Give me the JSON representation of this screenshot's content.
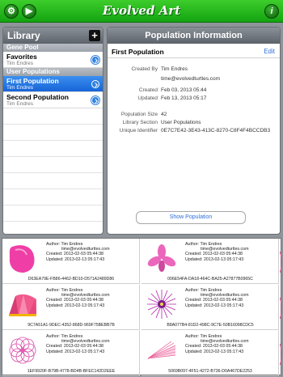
{
  "app": {
    "title": "Evolved Art"
  },
  "toolbar": {
    "settings_icon": "gear-icon",
    "play_icon": "play-icon",
    "info_icon": "info-icon"
  },
  "library": {
    "title": "Library",
    "add_label": "+",
    "sections": [
      {
        "title": "Gene Pool",
        "rows": [
          {
            "name": "Favorites",
            "author": "Tim Endres",
            "selected": false
          }
        ]
      },
      {
        "title": "User Populations",
        "rows": [
          {
            "name": "First Population",
            "author": "Tim Endres",
            "selected": true
          },
          {
            "name": "Second Population",
            "author": "Tim Endres",
            "selected": false
          }
        ]
      }
    ]
  },
  "info": {
    "title": "Population Information",
    "name": "First Population",
    "edit_label": "Edit",
    "fields": [
      {
        "label": "Created By",
        "value": "Tim Endres"
      },
      {
        "label": "",
        "value": "time@evolvedturtles.com"
      },
      {
        "label": "Created",
        "value": "Feb 03, 2013 05:44"
      },
      {
        "label": "Updated",
        "value": "Feb 13, 2013 05:17"
      },
      {
        "label": "Population Size",
        "value": "42"
      },
      {
        "label": "Library Section",
        "value": "User Populations"
      },
      {
        "label": "Unique Identifier",
        "value": "0E7C7E42-3E43-413C-8270-C8F4F4BCCDB3"
      }
    ],
    "show_button": "Show Population"
  },
  "grid": {
    "cells": [
      {
        "author": "Tim Endres",
        "email": "time@evolvedturtles.com",
        "created": "2013-02-03 05:44:38",
        "updated": "2013-02-13 05:17:43",
        "uuid": "D63EA79E-FB86-4462-BD10-D571A2489D86",
        "thumb": "pink-blob"
      },
      {
        "author": "Tim Endres",
        "email": "time@evolvedturtles.com",
        "created": "2013-02-03 05:44:38",
        "updated": "2013-02-13 05:17:43",
        "uuid": "006E54FA-DA18-464C-BA25-A27877B0965C",
        "thumb": "pink-petals"
      },
      {
        "author": "Tim Endres",
        "email": "time@evolvedturtles.com",
        "created": "2013-02-03 05:44:38",
        "updated": "2013-02-13 05:17:43",
        "uuid": "9C7A51A1-9DEC-4352-868D-969F75BEBB7B",
        "thumb": "fan"
      },
      {
        "author": "Tim Endres",
        "email": "time@evolvedturtles.com",
        "created": "2013-02-03 05:44:38",
        "updated": "2013-02-13 05:17:43",
        "uuid": "B8A077B4-81D2-498C-9C7E-50B16098CDC5",
        "thumb": "starburst"
      },
      {
        "author": "Tim Endres",
        "email": "time@evolvedturtles.com",
        "created": "2013-02-03 05:44:38",
        "updated": "2013-02-13 05:17:43",
        "uuid": "1EF9920F-B79B-4778-BD4B-BFEC142D2EEE",
        "thumb": "rosette"
      },
      {
        "author": "Tim Endres",
        "email": "time@evolvedturtles.com",
        "created": "2013-02-03 05:44:38",
        "updated": "2013-02-13 05:17:43",
        "uuid": "5069B097-4F51-4272-B736-D0A467DE2253",
        "thumb": "rays"
      }
    ],
    "labels": {
      "author": "Author:",
      "created": "Created:",
      "updated": "Updated:"
    }
  }
}
